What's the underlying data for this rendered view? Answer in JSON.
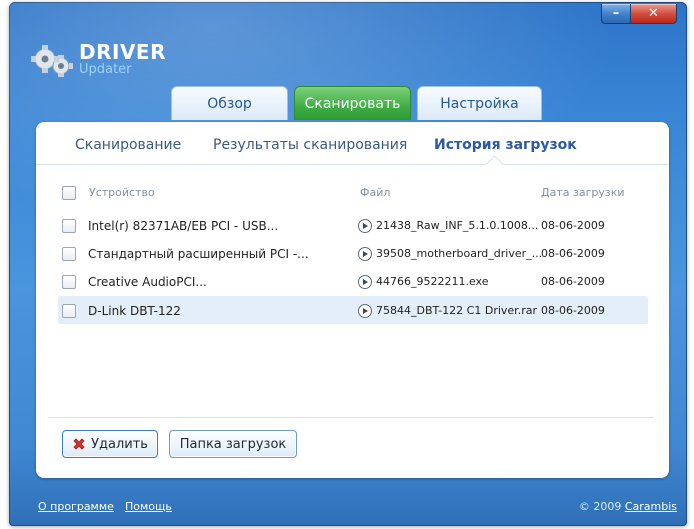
{
  "window": {
    "logo": {
      "title": "DRIVER",
      "subtitle": "Updater"
    }
  },
  "tabs": [
    {
      "label": "Обзор",
      "active": false
    },
    {
      "label": "Сканировать",
      "active": true
    },
    {
      "label": "Настройка",
      "active": false
    }
  ],
  "subtabs": [
    {
      "label": "Сканирование",
      "active": false
    },
    {
      "label": "Результаты сканирования",
      "active": false
    },
    {
      "label": "История загрузок",
      "active": true
    }
  ],
  "table": {
    "headers": {
      "device": "Устройство",
      "file": "Файл",
      "date": "Дата загрузки"
    },
    "rows": [
      {
        "device": "Intel(r) 82371AB/EB PCI - USB...",
        "file": "21438_Raw_INF_5.1.0.1008...",
        "date": "08-06-2009",
        "checked": false,
        "selected": false
      },
      {
        "device": "Стандартный расширенный PCI -...",
        "file": "39508_motherboard_driver_...",
        "date": "08-06-2009",
        "checked": false,
        "selected": false
      },
      {
        "device": "Creative AudioPCI...",
        "file": "44766_9522211.exe",
        "date": "08-06-2009",
        "checked": false,
        "selected": false
      },
      {
        "device": "D-Link DBT-122",
        "file": "75844_DBT-122 C1 Driver.rar",
        "date": "08-06-2009",
        "checked": false,
        "selected": true
      }
    ]
  },
  "buttons": {
    "delete": "Удалить",
    "downloads_folder": "Папка загрузок"
  },
  "footer": {
    "about": "О программе",
    "help": "Помощь",
    "copyright_prefix": "© 2009",
    "brand": "Carambis"
  },
  "icons": {
    "logo": "gears-icon",
    "play": "play-circle-icon",
    "delete": "red-x-icon",
    "minimize": "minimize-icon",
    "close": "close-icon"
  },
  "colors": {
    "accent_green": "#3fae44",
    "accent_blue": "#2d74c8",
    "selected_row": "#e4eef8"
  }
}
